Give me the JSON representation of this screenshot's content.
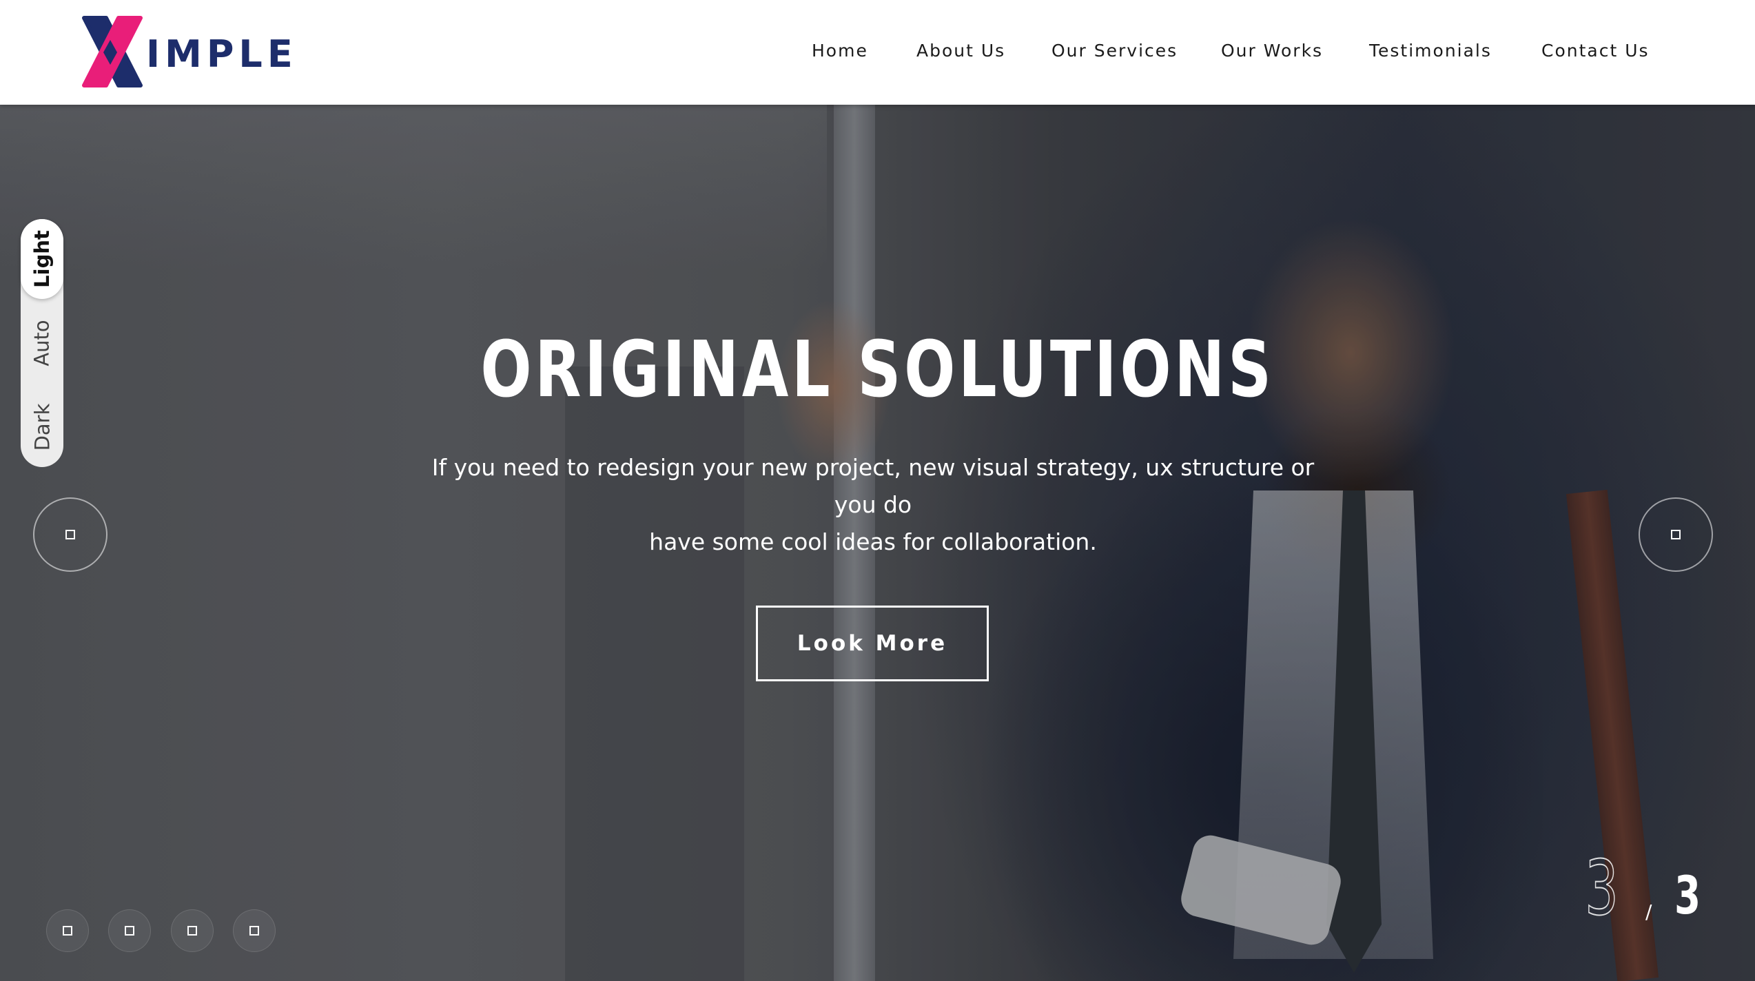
{
  "brand": {
    "logo_text": "IMPLE",
    "colors": {
      "pink": "#e91e79",
      "navy": "#1d2d6b"
    }
  },
  "nav": {
    "items": [
      {
        "label": "Home"
      },
      {
        "label": "About Us"
      },
      {
        "label": "Our Services"
      },
      {
        "label": "Our Works"
      },
      {
        "label": "Testimonials"
      },
      {
        "label": "Contact Us"
      }
    ]
  },
  "hero": {
    "title": "ORIGINAL SOLUTIONS",
    "subtitle_line1": "If you need to redesign your new project, new visual strategy, ux structure or you do",
    "subtitle_line2": "have some cool ideas for collaboration.",
    "cta_label": "Look More"
  },
  "theme_switch": {
    "options": [
      {
        "label": "Light",
        "active": true
      },
      {
        "label": "Auto",
        "active": false
      },
      {
        "label": "Dark",
        "active": false
      }
    ]
  },
  "slider": {
    "current": "3",
    "separator": "/",
    "total": "3",
    "prev_icon": "arrow-left-icon",
    "next_icon": "arrow-right-icon"
  },
  "social": {
    "icons": [
      "facebook-icon",
      "twitter-icon",
      "instagram-icon",
      "linkedin-icon"
    ]
  }
}
